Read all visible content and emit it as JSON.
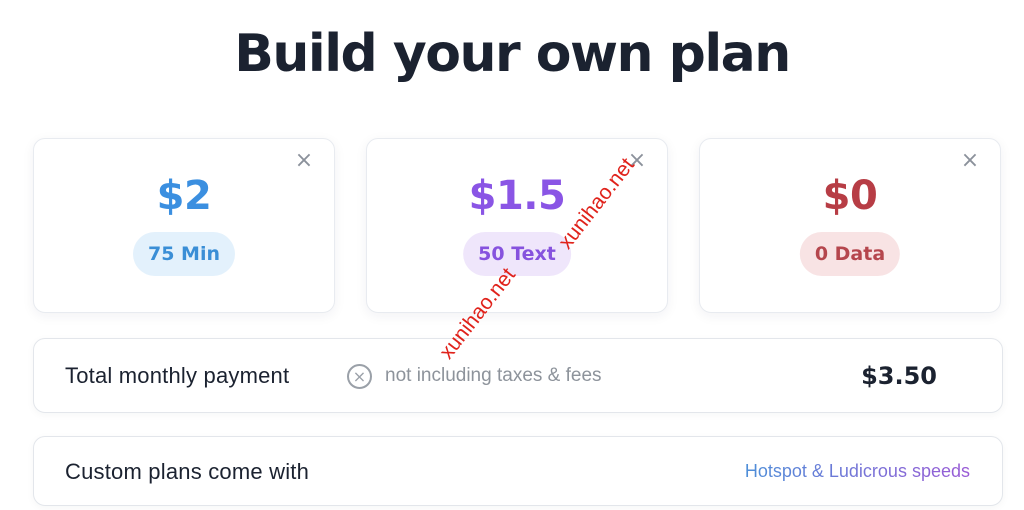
{
  "page": {
    "title": "Build your own plan"
  },
  "cards": [
    {
      "price": "$2",
      "pill": "75 Min",
      "price_color": "#3b8fe0",
      "pill_bg": "#e3f1fc",
      "pill_color": "#3a8ed6",
      "close_icon": "close-icon"
    },
    {
      "price": "$1.5",
      "pill": "50 Text",
      "price_color": "#8a55e5",
      "pill_bg": "#efe6fb",
      "pill_color": "#8652de",
      "close_icon": "close-icon"
    },
    {
      "price": "$0",
      "pill": "0 Data",
      "price_color": "#b73d45",
      "pill_bg": "#f8e3e4",
      "pill_color": "#b5464d",
      "close_icon": "close-icon"
    }
  ],
  "total_row": {
    "label": "Total monthly payment",
    "note": "not including taxes & fees",
    "amount": "$3.50",
    "info_icon": "close-circle-icon"
  },
  "custom_row": {
    "label": "Custom plans come with",
    "features": "Hotspot & Ludicrous speeds",
    "features_gradient": [
      "#4e8fd8",
      "#9a5ad6"
    ]
  },
  "watermark": {
    "text_1": "xunihao.net",
    "text_2": "xunihao.net"
  }
}
